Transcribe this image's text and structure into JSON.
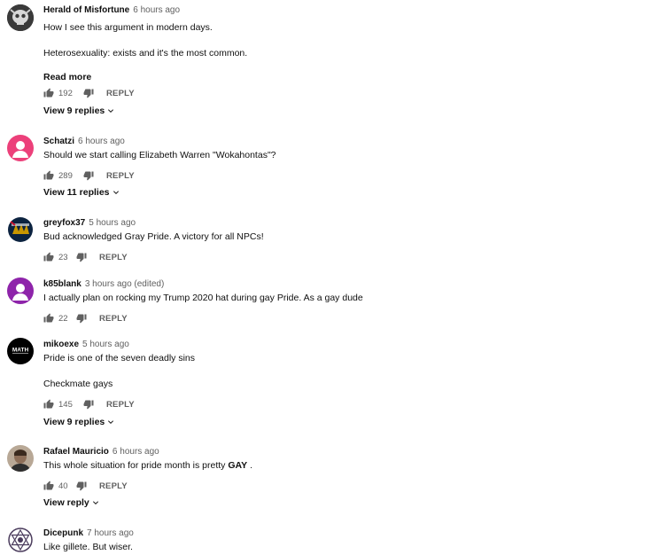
{
  "comments": [
    {
      "author": "Herald of Misfortune",
      "time": "6 hours ago",
      "lines": [
        "How I see this argument in modern days.",
        "Heterosexuality: exists and it's the most common."
      ],
      "read_more": "Read more",
      "likes": "192",
      "reply_label": "REPLY",
      "view_replies": "View 9 replies",
      "avatar": "skull-avatar"
    },
    {
      "author": "Schatzi",
      "time": "6 hours ago",
      "lines": [
        "Should we start calling Elizabeth Warren \"Wokahontas\"?"
      ],
      "likes": "289",
      "reply_label": "REPLY",
      "view_replies": "View 11 replies",
      "avatar": "default-person-avatar",
      "avatar_color": "#ec407a"
    },
    {
      "author": "greyfox37",
      "time": "5 hours ago",
      "lines": [
        "Bud acknowledged Gray Pride. A victory for all NPCs!"
      ],
      "likes": "23",
      "reply_label": "REPLY",
      "avatar": "sports-logo-avatar"
    },
    {
      "author": "k85blank",
      "time": "3 hours ago (edited)",
      "lines": [
        "I actually plan on rocking my Trump 2020 hat during gay Pride. As a gay dude"
      ],
      "likes": "22",
      "reply_label": "REPLY",
      "avatar": "default-person-avatar",
      "avatar_color": "#8e24aa"
    },
    {
      "author": "mikoexe",
      "time": "5 hours ago",
      "lines": [
        "Pride is one of the seven deadly sins",
        "Checkmate gays"
      ],
      "likes": "145",
      "reply_label": "REPLY",
      "view_replies": "View 9 replies",
      "avatar": "math-logo-avatar",
      "avatar_text": "MATH"
    },
    {
      "author": "Rafael Mauricio",
      "time": "6 hours ago",
      "text_before": "This whole situation for pride month is pretty ",
      "text_bold": "GAY",
      "text_after": " .",
      "likes": "40",
      "reply_label": "REPLY",
      "view_replies": "View reply",
      "avatar": "photo-avatar"
    },
    {
      "author": "Dicepunk",
      "time": "7 hours ago",
      "lines": [
        "Like gillete. But wiser."
      ],
      "avatar": "hexagram-avatar"
    }
  ]
}
